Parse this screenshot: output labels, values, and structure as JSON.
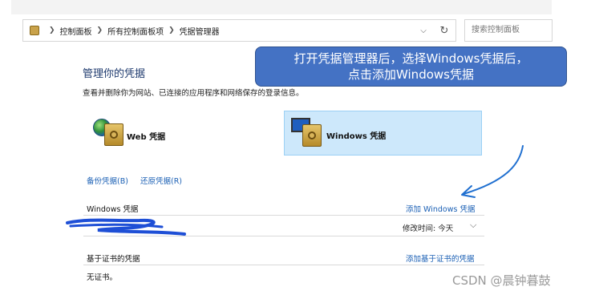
{
  "address_bar": {
    "crumbs": [
      "控制面板",
      "所有控制面板项",
      "凭据管理器"
    ],
    "search_placeholder": "搜索控制面板"
  },
  "page": {
    "title": "管理你的凭据",
    "subtitle": "查看并删除你为网站、已连接的应用程序和网络保存的登录信息。"
  },
  "callout": {
    "line1": "打开凭据管理器后，选择Windows凭据后，",
    "line2": "点击添加Windows凭据"
  },
  "credential_types": {
    "web_label": "Web 凭据",
    "windows_label": "Windows 凭据",
    "selected": "windows"
  },
  "actions": {
    "backup": "备份凭据(B)",
    "restore": "还原凭据(R)"
  },
  "windows_section": {
    "header": "Windows 凭据",
    "add_link": "添加 Windows 凭据",
    "entry_modified": "修改时间:  今天"
  },
  "cert_section": {
    "header": "基于证书的凭据",
    "add_link": "添加基于证书的凭据",
    "empty_text": "无证书。"
  },
  "watermark": "CSDN @晨钟暮鼓",
  "colors": {
    "link": "#1a5fb4",
    "callout_bg": "#4472c4",
    "selected_tile_bg": "#cde8fb"
  }
}
